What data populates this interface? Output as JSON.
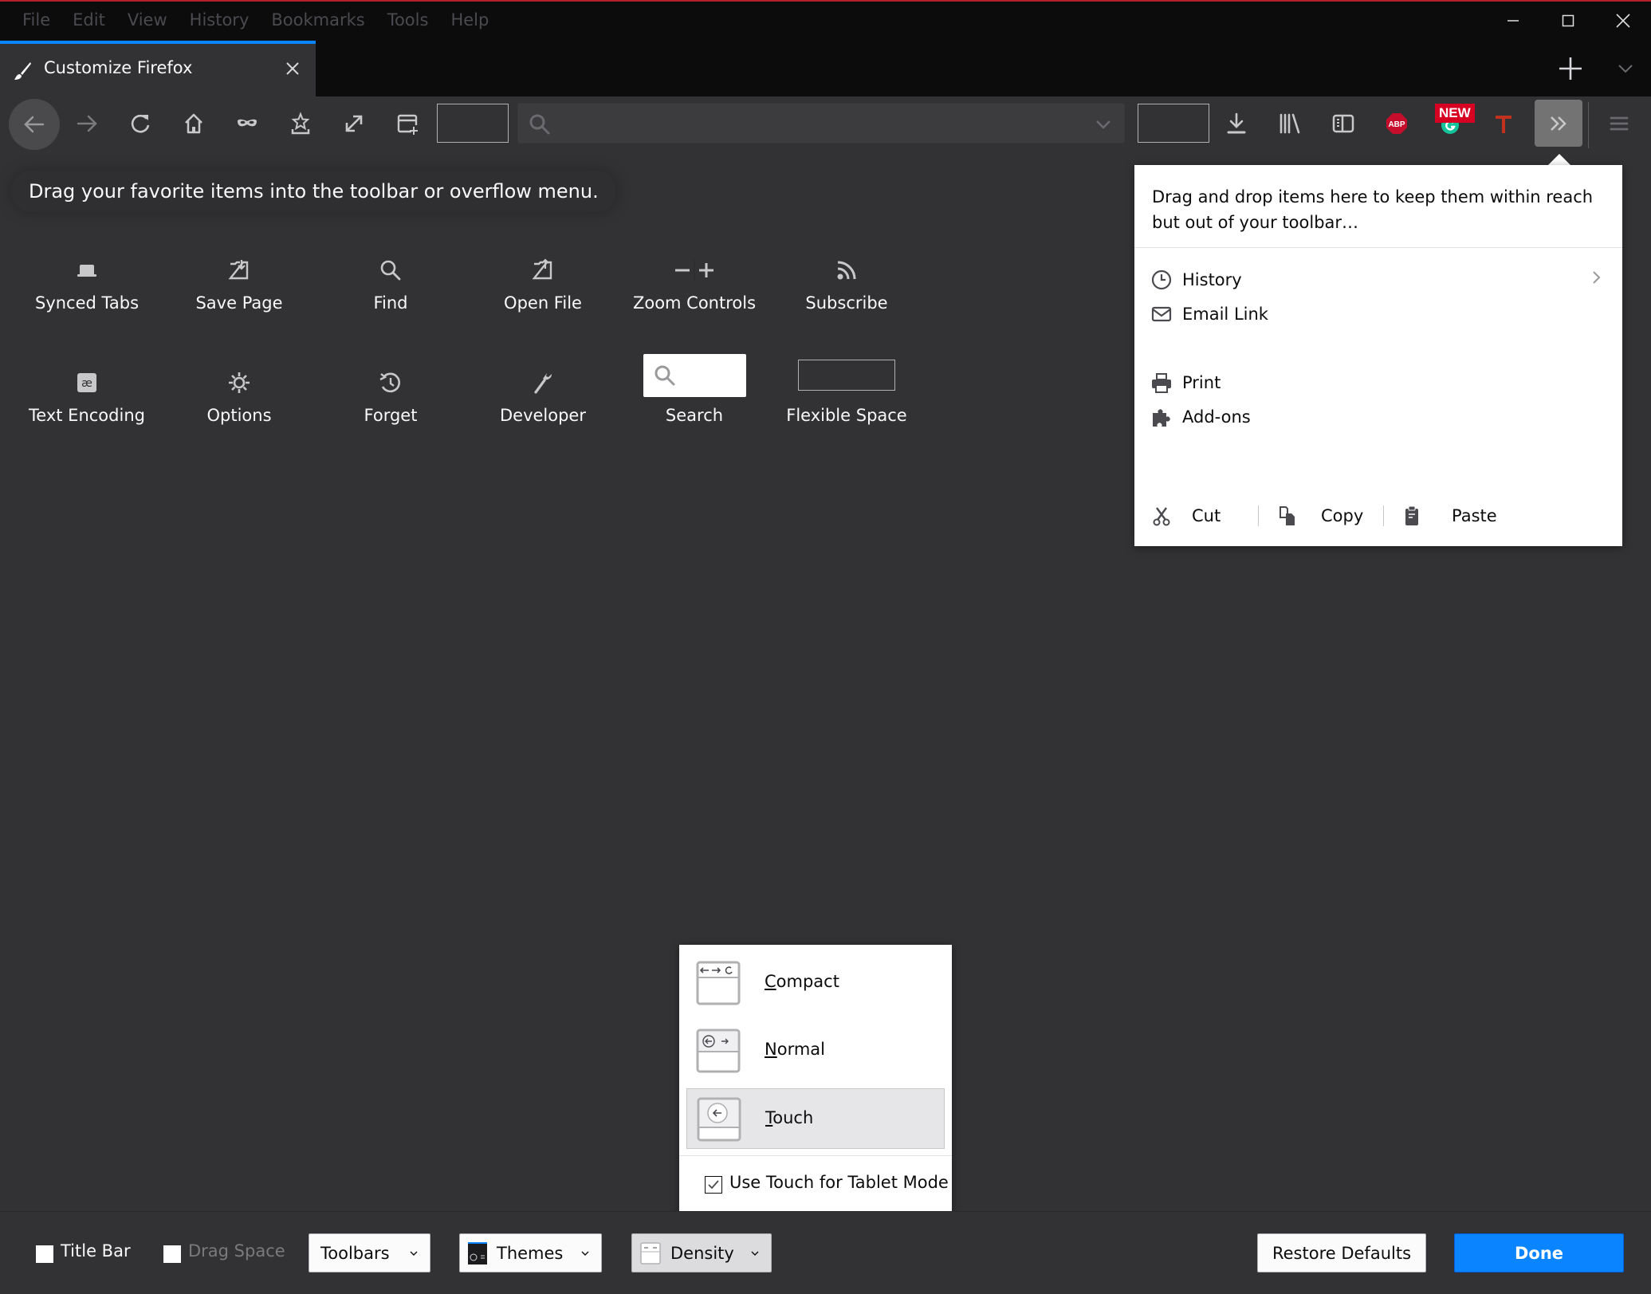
{
  "menubar": {
    "items": [
      "File",
      "Edit",
      "View",
      "History",
      "Bookmarks",
      "Tools",
      "Help"
    ]
  },
  "window_controls": [
    "minimize-icon",
    "maximize-icon",
    "close-icon"
  ],
  "tab": {
    "title": "Customize Firefox",
    "icon": "paintbrush-icon",
    "active_color": "#0a84ff"
  },
  "toolbar": {
    "buttons": [
      "back",
      "forward",
      "reload",
      "home",
      "private-browsing",
      "save-to-pocket",
      "fullscreen",
      "new-window",
      "flexible-space",
      "url-bar",
      "flexible-space",
      "downloads",
      "library",
      "sidebars",
      "adblock-plus",
      "grammarly",
      "text-extension",
      "overflow-menu",
      "hamburger-menu"
    ],
    "new_badge": "NEW",
    "abp_label": "ABP"
  },
  "palette": {
    "hint": "Drag your favorite items into the toolbar or overflow menu.",
    "items": [
      {
        "label": "Synced Tabs",
        "icon": "synced-tabs-icon"
      },
      {
        "label": "Save Page",
        "icon": "save-page-icon"
      },
      {
        "label": "Find",
        "icon": "find-icon"
      },
      {
        "label": "Open File",
        "icon": "open-file-icon"
      },
      {
        "label": "Zoom Controls",
        "icon": "zoom-controls-icon"
      },
      {
        "label": "Subscribe",
        "icon": "rss-icon"
      },
      {
        "label": "Text Encoding",
        "icon": "text-encoding-icon"
      },
      {
        "label": "Options",
        "icon": "gear-icon"
      },
      {
        "label": "Forget",
        "icon": "forget-icon"
      },
      {
        "label": "Developer",
        "icon": "wrench-icon"
      },
      {
        "label": "Search",
        "icon": "search-box-icon"
      },
      {
        "label": "Flexible Space",
        "icon": "flexible-space-icon"
      }
    ]
  },
  "overflow_panel": {
    "description": "Drag and drop items here to keep them within reach but out of your toolbar…",
    "items": [
      {
        "label": "History",
        "icon": "clock-icon",
        "has_submenu": true
      },
      {
        "label": "Email Link",
        "icon": "envelope-icon"
      },
      {
        "label": "Print",
        "icon": "printer-icon"
      },
      {
        "label": "Add-ons",
        "icon": "puzzle-icon"
      }
    ],
    "edit_controls": [
      {
        "label": "Cut",
        "icon": "scissors-icon"
      },
      {
        "label": "Copy",
        "icon": "copy-icon"
      },
      {
        "label": "Paste",
        "icon": "clipboard-icon"
      }
    ]
  },
  "density_popup": {
    "options": [
      {
        "label": "Compact",
        "accesskey": "C",
        "rest": "ompact",
        "selected": false
      },
      {
        "label": "Normal",
        "accesskey": "N",
        "rest": "ormal",
        "selected": false
      },
      {
        "label": "Touch",
        "accesskey": "T",
        "rest": "ouch",
        "selected": true
      }
    ],
    "tablet_checkbox_label": "Use Touch for Tablet Mode",
    "tablet_checkbox_checked": true
  },
  "bottom_bar": {
    "title_bar_label": "Title Bar",
    "title_bar_checked": false,
    "drag_space_label": "Drag Space",
    "drag_space_checked": false,
    "drag_space_disabled": true,
    "toolbars_label": "Toolbars",
    "themes_label": "Themes",
    "density_label": "Density",
    "restore_label": "Restore Defaults",
    "done_label": "Done"
  },
  "colors": {
    "accent": "#0a84ff",
    "background": "#323234",
    "titlebar": "#0c0c0d"
  }
}
